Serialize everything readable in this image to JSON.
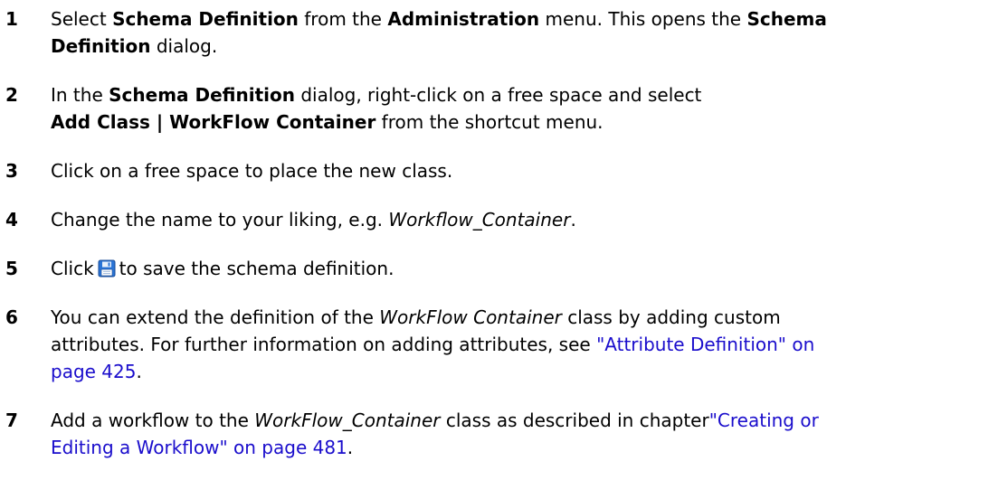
{
  "steps": [
    {
      "number": "1",
      "line1": {
        "t1": "Select ",
        "b1": "Schema Definition",
        "t2": " from the ",
        "b2": "Administration",
        "t3": " menu. This opens the ",
        "b3": "Schema"
      },
      "line2": {
        "b1": "Definition",
        "t1": " dialog."
      }
    },
    {
      "number": "2",
      "line1": {
        "t1": "In the ",
        "b1": "Schema Definition",
        "t2": " dialog, right-click on a free space and select"
      },
      "line2": {
        "b1": "Add Class | WorkFlow Container",
        "t1": " from the shortcut menu."
      }
    },
    {
      "number": "3",
      "text": "Click on a free space to place the new class."
    },
    {
      "number": "4",
      "t1": "Change the name to your liking, e.g. ",
      "i1": "Workflow_Container",
      "t2": "."
    },
    {
      "number": "5",
      "t1": "Click",
      "icon": "save-icon",
      "t2": "to save the schema definition."
    },
    {
      "number": "6",
      "line1": {
        "t1": "You can extend the definition of the ",
        "i1": "WorkFlow Container",
        "t2": " class by adding custom"
      },
      "line2": {
        "t1": "attributes. For further information on adding attributes, see ",
        "link": "\"Attribute Definition\" on"
      },
      "line3": {
        "link": "page 425",
        "t1": "."
      }
    },
    {
      "number": "7",
      "line1": {
        "t1": "Add a workflow to the ",
        "i1": "WorkFlow_Container",
        "t2": " class as described in chapter",
        "link": "\"Creating or"
      },
      "line2": {
        "link": "Editing a Workflow\" on page 481",
        "t1": "."
      }
    }
  ],
  "colors": {
    "link": "#1a0dcc",
    "icon_blue": "#2a74d6"
  }
}
